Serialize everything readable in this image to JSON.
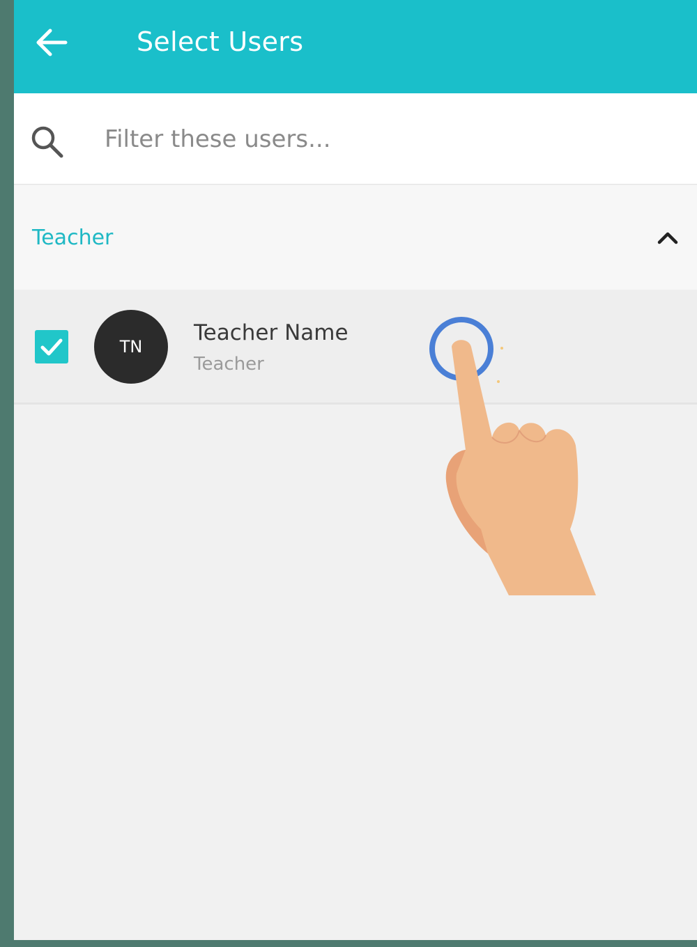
{
  "header": {
    "title": "Select Users",
    "back_icon": "arrow-left-icon",
    "background_color": "#1abfca"
  },
  "search": {
    "placeholder": "Filter these users...",
    "value": "",
    "icon": "search-icon"
  },
  "group": {
    "label": "Teacher",
    "expanded": true,
    "toggle_icon": "chevron-up-icon",
    "label_color": "#1fb8c4"
  },
  "users": [
    {
      "initials": "TN",
      "name": "Teacher Name",
      "role": "Teacher",
      "selected": true
    }
  ],
  "overlay": {
    "icon": "tap-hand-icon",
    "ring_color": "#4a7fd6"
  }
}
